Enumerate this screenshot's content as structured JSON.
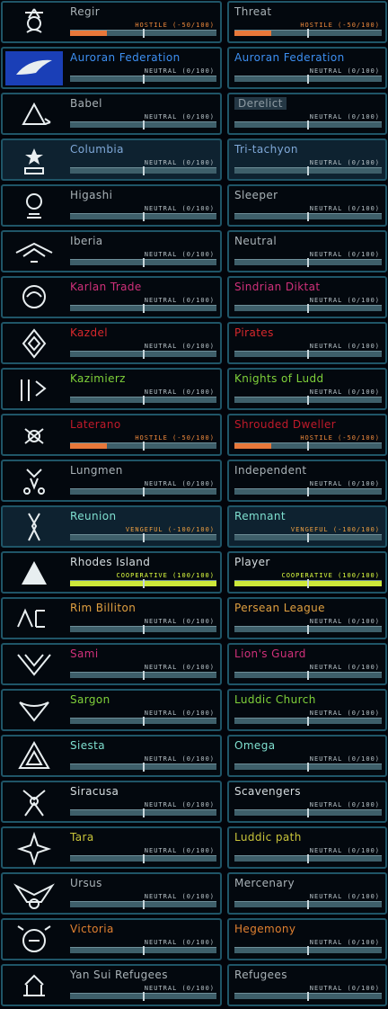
{
  "colors": {
    "hostile_text": "#f08a3c",
    "vengeful_text": "#f0a040",
    "cooperative_text": "#dfff40",
    "neutral_text": "#b7c2c7",
    "fill_hostile": "#e8783a",
    "fill_vengeful": "#f08a40",
    "fill_cooperative": "#cde83a"
  },
  "factions": [
    {
      "name": "Regir",
      "name_color": "#a9b2b7",
      "icon": "regir-emblem-icon",
      "status_label": "HOSTILE (-50/100)",
      "status_level": "hostile",
      "relation": -50,
      "pair": {
        "name": "Threat",
        "name_color": "#a9b2b7",
        "status_label": "HOSTILE (-50/100)",
        "status_level": "hostile",
        "relation": -50
      }
    },
    {
      "name": "Auroran Federation",
      "name_color": "#3d8ff2",
      "icon": "auroran-bird-emblem-icon",
      "status_label": "NEUTRAL (0/100)",
      "status_level": "neutral",
      "relation": 0,
      "pair": {
        "name": "Auroran Federation",
        "name_color": "#3d8ff2",
        "status_label": "NEUTRAL (0/100)",
        "status_level": "neutral",
        "relation": 0
      }
    },
    {
      "name": "Babel",
      "name_color": "#a9b2b7",
      "icon": "babel-emblem-icon",
      "status_label": "NEUTRAL (0/100)",
      "status_level": "neutral",
      "relation": 0,
      "pair": {
        "name": "Derelict",
        "name_color": "#8d9aa2",
        "tag": true,
        "status_label": "NEUTRAL (0/100)",
        "status_level": "neutral",
        "relation": 0
      }
    },
    {
      "name": "Columbia",
      "name_color": "#7fa8d8",
      "icon": "columbia-star-emblem-icon",
      "highlight": true,
      "status_label": "NEUTRAL (0/100)",
      "status_level": "neutral",
      "relation": 0,
      "pair": {
        "name": "Tri-tachyon",
        "name_color": "#7fa8d8",
        "highlight": true,
        "status_label": "NEUTRAL (0/100)",
        "status_level": "neutral",
        "relation": 0
      }
    },
    {
      "name": "Higashi",
      "name_color": "#a9b2b7",
      "icon": "higashi-crest-icon",
      "status_label": "NEUTRAL (0/100)",
      "status_level": "neutral",
      "relation": 0,
      "pair": {
        "name": "Sleeper",
        "name_color": "#a9b2b7",
        "status_label": "NEUTRAL (0/100)",
        "status_level": "neutral",
        "relation": 0
      }
    },
    {
      "name": "Iberia",
      "name_color": "#a9b2b7",
      "icon": "iberia-wings-emblem-icon",
      "status_label": "NEUTRAL (0/100)",
      "status_level": "neutral",
      "relation": 0,
      "pair": {
        "name": "Neutral",
        "name_color": "#a9b2b7",
        "status_label": "NEUTRAL (0/100)",
        "status_level": "neutral",
        "relation": 0
      }
    },
    {
      "name": "Karlan Trade",
      "name_color": "#d0307a",
      "icon": "karlan-trade-emblem-icon",
      "status_label": "NEUTRAL (0/100)",
      "status_level": "neutral",
      "relation": 0,
      "pair": {
        "name": "Sindrian Diktat",
        "name_color": "#d0307a",
        "status_label": "NEUTRAL (0/100)",
        "status_level": "neutral",
        "relation": 0
      }
    },
    {
      "name": "Kazdel",
      "name_color": "#d8282c",
      "icon": "kazdel-emblem-icon",
      "status_label": "NEUTRAL (0/100)",
      "status_level": "neutral",
      "relation": 0,
      "pair": {
        "name": "Pirates",
        "name_color": "#d8282c",
        "status_label": "NEUTRAL (0/100)",
        "status_level": "neutral",
        "relation": 0
      }
    },
    {
      "name": "Kazimierz",
      "name_color": "#7fd13a",
      "icon": "kazimierz-knights-emblem-icon",
      "status_label": "NEUTRAL (0/100)",
      "status_level": "neutral",
      "relation": 0,
      "pair": {
        "name": "Knights of Ludd",
        "name_color": "#7fd13a",
        "status_label": "NEUTRAL (0/100)",
        "status_level": "neutral",
        "relation": 0
      }
    },
    {
      "name": "Laterano",
      "name_color": "#c01a2a",
      "icon": "laterano-emblem-icon",
      "status_label": "HOSTILE (-50/100)",
      "status_level": "hostile",
      "relation": -50,
      "pair": {
        "name": "Shrouded Dweller",
        "name_color": "#c01a2a",
        "status_label": "HOSTILE (-50/100)",
        "status_level": "hostile",
        "relation": -50
      }
    },
    {
      "name": "Lungmen",
      "name_color": "#a9b2b7",
      "icon": "lungmen-emblem-icon",
      "status_label": "NEUTRAL (0/100)",
      "status_level": "neutral",
      "relation": 0,
      "pair": {
        "name": "Independent",
        "name_color": "#a9b2b7",
        "status_label": "NEUTRAL (0/100)",
        "status_level": "neutral",
        "relation": 0
      }
    },
    {
      "name": "Reunion",
      "name_color": "#7fe0d0",
      "icon": "reunion-emblem-icon",
      "highlight": true,
      "status_label": "VENGEFUL (-100/100)",
      "status_level": "vengeful",
      "relation": -100,
      "pair": {
        "name": "Remnant",
        "name_color": "#7fe0d0",
        "highlight": true,
        "status_label": "VENGEFUL (-100/100)",
        "status_level": "vengeful",
        "relation": -100
      }
    },
    {
      "name": "Rhodes Island",
      "name_color": "#d6dde0",
      "icon": "rhodes-island-emblem-icon",
      "status_label": "COOPERATIVE (100/100)",
      "status_level": "cooperative",
      "relation": 100,
      "pair": {
        "name": "Player",
        "name_color": "#d6dde0",
        "status_label": "COOPERATIVE (100/100)",
        "status_level": "cooperative",
        "relation": 100
      }
    },
    {
      "name": "Rim Billiton",
      "name_color": "#e0a040",
      "icon": "rim-billiton-logo-icon",
      "status_label": "NEUTRAL (0/100)",
      "status_level": "neutral",
      "relation": 0,
      "pair": {
        "name": "Persean League",
        "name_color": "#e0a040",
        "status_label": "NEUTRAL (0/100)",
        "status_level": "neutral",
        "relation": 0
      }
    },
    {
      "name": "Sami",
      "name_color": "#d0307a",
      "icon": "sami-emblem-icon",
      "status_label": "NEUTRAL (0/100)",
      "status_level": "neutral",
      "relation": 0,
      "pair": {
        "name": "Lion's Guard",
        "name_color": "#d0307a",
        "status_label": "NEUTRAL (0/100)",
        "status_level": "neutral",
        "relation": 0
      }
    },
    {
      "name": "Sargon",
      "name_color": "#7fd13a",
      "icon": "sargon-emblem-icon",
      "status_label": "NEUTRAL (0/100)",
      "status_level": "neutral",
      "relation": 0,
      "pair": {
        "name": "Luddic Church",
        "name_color": "#7fd13a",
        "status_label": "NEUTRAL (0/100)",
        "status_level": "neutral",
        "relation": 0
      }
    },
    {
      "name": "Siesta",
      "name_color": "#7fe0d0",
      "icon": "siesta-triangle-emblem-icon",
      "status_label": "NEUTRAL (0/100)",
      "status_level": "neutral",
      "relation": 0,
      "pair": {
        "name": "Omega",
        "name_color": "#7fe0d0",
        "status_label": "NEUTRAL (0/100)",
        "status_level": "neutral",
        "relation": 0
      }
    },
    {
      "name": "Siracusa",
      "name_color": "#d6dde0",
      "icon": "siracusa-wolf-emblem-icon",
      "status_label": "NEUTRAL (0/100)",
      "status_level": "neutral",
      "relation": 0,
      "pair": {
        "name": "Scavengers",
        "name_color": "#d6dde0",
        "status_label": "NEUTRAL (0/100)",
        "status_level": "neutral",
        "relation": 0
      }
    },
    {
      "name": "Tara",
      "name_color": "#c8c43a",
      "icon": "tara-star-emblem-icon",
      "status_label": "NEUTRAL (0/100)",
      "status_level": "neutral",
      "relation": 0,
      "pair": {
        "name": "Luddic path",
        "name_color": "#c8c43a",
        "status_label": "NEUTRAL (0/100)",
        "status_level": "neutral",
        "relation": 0
      }
    },
    {
      "name": "Ursus",
      "name_color": "#a9b2b7",
      "icon": "ursus-eagle-emblem-icon",
      "status_label": "NEUTRAL (0/100)",
      "status_level": "neutral",
      "relation": 0,
      "pair": {
        "name": "Mercenary",
        "name_color": "#a9b2b7",
        "status_label": "NEUTRAL (0/100)",
        "status_level": "neutral",
        "relation": 0
      }
    },
    {
      "name": "Victoria",
      "name_color": "#e08030",
      "icon": "victoria-crest-icon",
      "status_label": "NEUTRAL (0/100)",
      "status_level": "neutral",
      "relation": 0,
      "pair": {
        "name": "Hegemony",
        "name_color": "#e08030",
        "status_label": "NEUTRAL (0/100)",
        "status_level": "neutral",
        "relation": 0
      }
    },
    {
      "name": "Yan Sui Refugees",
      "name_color": "#a9b2b7",
      "icon": "yan-sui-emblem-icon",
      "status_label": "NEUTRAL (0/100)",
      "status_level": "neutral",
      "relation": 0,
      "pair": {
        "name": "Refugees",
        "name_color": "#a9b2b7",
        "status_label": "NEUTRAL (0/100)",
        "status_level": "neutral",
        "relation": 0
      }
    }
  ]
}
